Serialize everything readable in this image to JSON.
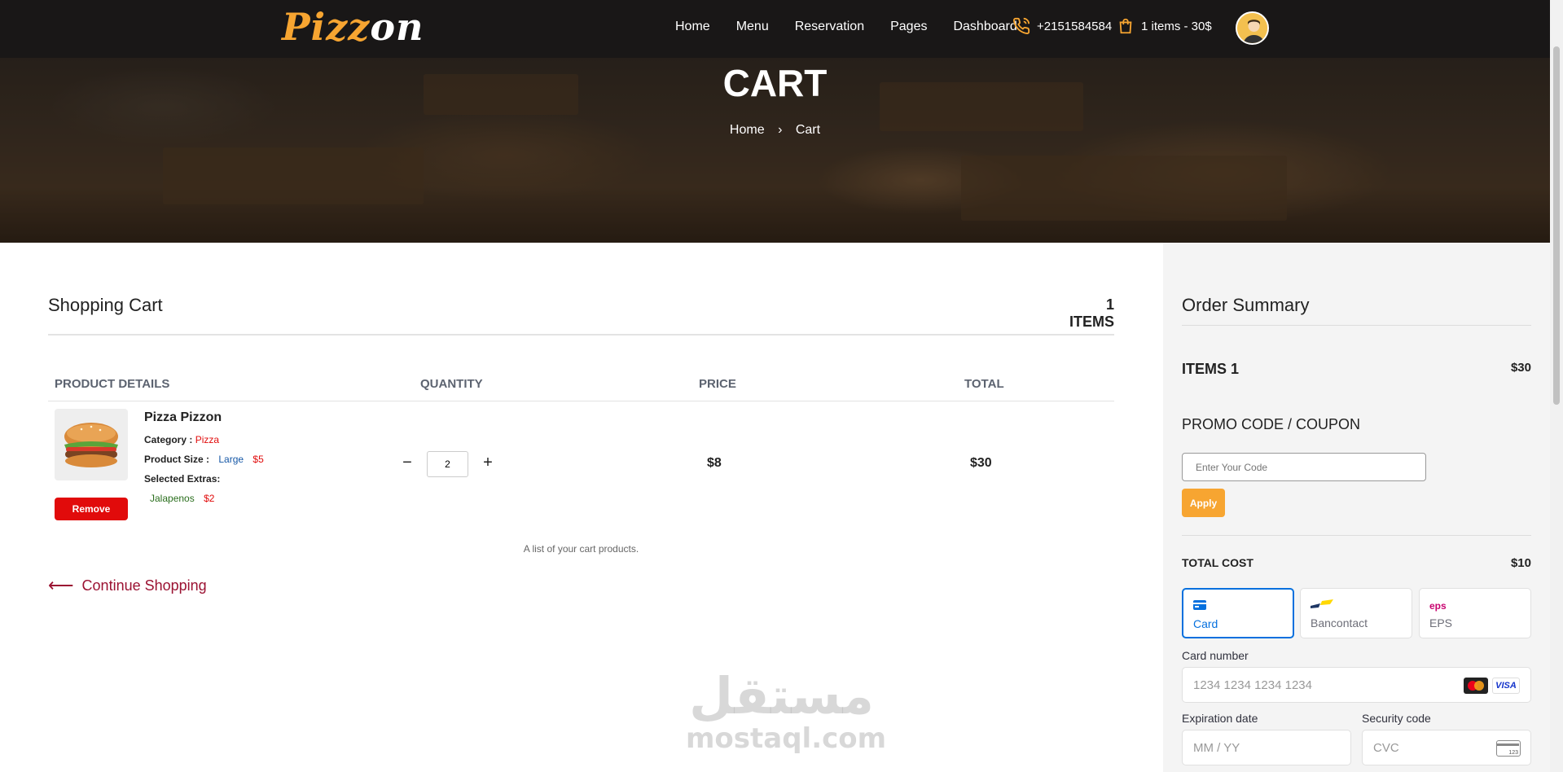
{
  "navbar": {
    "logo_part1": "Pizz",
    "logo_part2": "on",
    "links": [
      "Home",
      "Menu",
      "Reservation",
      "Pages",
      "Dashboard"
    ],
    "phone": "+2151584584",
    "cart_summary": "1 items - 30$"
  },
  "hero": {
    "title": "CART",
    "breadcrumb": [
      "Home",
      "Cart"
    ]
  },
  "cart": {
    "title": "Shopping Cart",
    "count_label": "1 ITEMS",
    "columns": [
      "PRODUCT DETAILS",
      "QUANTITY",
      "PRICE",
      "TOTAL"
    ],
    "item": {
      "name": "Pizza Pizzon",
      "category_label": "Category :",
      "category": "Pizza",
      "size_label": "Product Size :",
      "size": "Large",
      "size_price": "$5",
      "extras_label": "Selected Extras:",
      "extra_name": "Jalapenos",
      "extra_price": "$2",
      "remove_label": "Remove",
      "quantity": "2",
      "price": "$8",
      "total": "$30"
    },
    "caption": "A list of your cart products.",
    "continue_label": "Continue Shopping"
  },
  "watermark": {
    "arabic": "مستقل",
    "latin": "mostaql.com"
  },
  "summary": {
    "title": "Order Summary",
    "items_label": "ITEMS 1",
    "items_value": "$30",
    "promo_label": "PROMO CODE / COUPON",
    "promo_placeholder": "Enter Your Code",
    "apply_label": "Apply",
    "total_label": "TOTAL COST",
    "total_value": "$10",
    "payment_tabs": [
      "Card",
      "Bancontact",
      "EPS"
    ],
    "active_tab": "Card",
    "card_number_label": "Card number",
    "card_number_placeholder": "1234 1234 1234 1234",
    "card_brand": "VISA",
    "expiry_label": "Expiration date",
    "expiry_placeholder": "MM / YY",
    "cvc_label": "Security code",
    "cvc_placeholder": "CVC",
    "cvc_icon_text": "123"
  },
  "colors": {
    "brand_orange": "#f7a531",
    "remove_red": "#e10b0b",
    "link_maroon": "#9b1232",
    "stripe_blue": "#0570de"
  }
}
